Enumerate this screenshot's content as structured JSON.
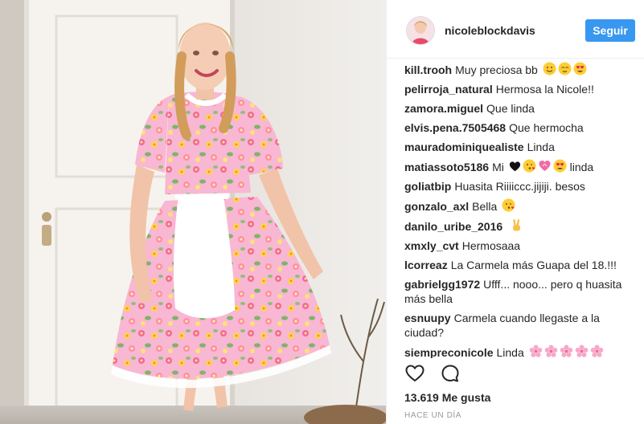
{
  "post": {
    "username": "nicoleblockdavis",
    "follow_label": "Seguir",
    "likes": "13.619 Me gusta",
    "time_ago": "HACE UN DÍA"
  },
  "comments": [
    {
      "user": "kill.trooh",
      "text": "Muy preciosa bb",
      "emojis": [
        "smile-emoji",
        "relieved-emoji",
        "heart-eyes-emoji"
      ]
    },
    {
      "user": "pelirroja_natural",
      "text": "Hermosa la Nicole!!",
      "emojis": []
    },
    {
      "user": "zamora.miguel",
      "text": "Que linda",
      "emojis": []
    },
    {
      "user": "elvis.pena.7505468",
      "text": "Que hermocha",
      "emojis": []
    },
    {
      "user": "mauradominiquealiste",
      "text": "Linda",
      "emojis": []
    },
    {
      "user": "matiassoto5186",
      "text": "Mi",
      "emojis": [
        "heart-emoji",
        "kiss-emoji",
        "ribbon-heart-emoji",
        "heart-eyes-emoji"
      ],
      "text_after": "linda"
    },
    {
      "user": "goliatbip",
      "text": "Huasita Riiiiccc.jijiji. besos",
      "emojis": []
    },
    {
      "user": "gonzalo_axl",
      "text": "Bella",
      "emojis": [
        "kiss-emoji"
      ]
    },
    {
      "user": "danilo_uribe_2016",
      "text": "",
      "emojis": [
        "victory-hand-emoji"
      ]
    },
    {
      "user": "xmxly_cvt",
      "text": "Hermosaaa",
      "emojis": []
    },
    {
      "user": "lcorreaz",
      "text": "La Carmela más Guapa del 18.!!!",
      "emojis": []
    },
    {
      "user": "gabrielgg1972",
      "text": "Ufff... nooo... pero q huasita más bella",
      "emojis": []
    },
    {
      "user": "esnuupy",
      "text": "Carmela cuando llegaste a la ciudad?",
      "emojis": []
    },
    {
      "user": "siempreconicole",
      "text": "Linda",
      "emojis": [
        "blossom-emoji",
        "blossom-emoji",
        "blossom-emoji",
        "blossom-emoji",
        "blossom-emoji"
      ]
    }
  ],
  "icons": {
    "like": "heart-outline-icon",
    "comment": "speech-bubble-icon"
  },
  "colors": {
    "follow_button": "#3897f0",
    "text": "#262626",
    "muted": "#999999",
    "dress": "#f7b3cf",
    "apron": "#ffffff"
  }
}
